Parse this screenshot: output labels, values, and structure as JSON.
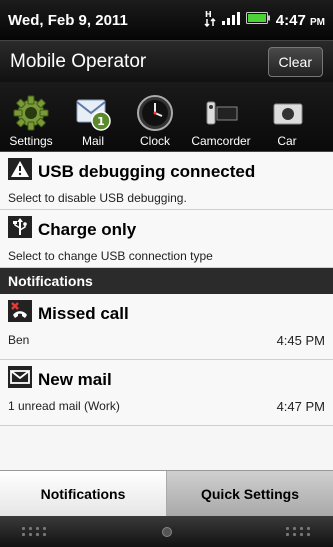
{
  "status": {
    "date": "Wed, Feb 9, 2011",
    "time": "4:47",
    "ampm": "PM",
    "icons": [
      "data-arrows-icon",
      "signal-icon",
      "battery-icon"
    ]
  },
  "header": {
    "operator": "Mobile Operator",
    "clear_label": "Clear"
  },
  "apps": [
    {
      "label": "Settings",
      "icon": "gear-icon"
    },
    {
      "label": "Mail",
      "icon": "mail-icon",
      "badge": "1"
    },
    {
      "label": "Clock",
      "icon": "clock-icon"
    },
    {
      "label": "Camcorder",
      "icon": "camcorder-icon"
    },
    {
      "label": "Car",
      "icon": "camera-icon"
    }
  ],
  "ongoing": [
    {
      "title": "USB debugging connected",
      "subtitle": "Select to disable USB debugging.",
      "icon": "warning-icon"
    },
    {
      "title": "Charge only",
      "subtitle": "Select to change USB connection type",
      "icon": "usb-icon"
    }
  ],
  "notifications_header": "Notifications",
  "notifications": [
    {
      "title": "Missed call",
      "subtitle": "Ben",
      "time": "4:45 PM",
      "icon": "missed-call-icon"
    },
    {
      "title": "New mail",
      "subtitle": "1 unread mail (Work)",
      "time": "4:47 PM",
      "icon": "envelope-icon"
    }
  ],
  "tabs": {
    "notifications": "Notifications",
    "quick_settings": "Quick Settings"
  },
  "colors": {
    "status_bar": "#050505",
    "section_header": "#2b2b2b",
    "battery": "#4cd137"
  }
}
